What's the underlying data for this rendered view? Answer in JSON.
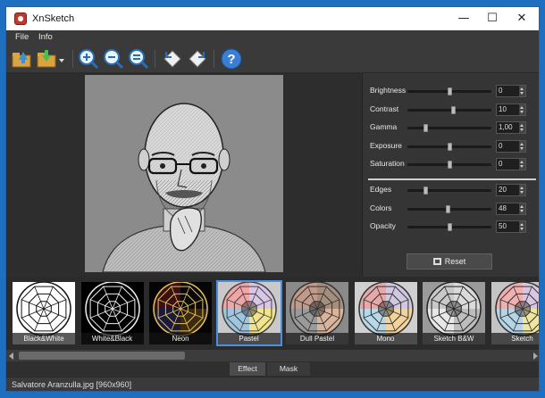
{
  "window": {
    "title": "XnSketch"
  },
  "menu": [
    "File",
    "Info"
  ],
  "toolbar": {
    "tools": [
      "open-folder-icon",
      "save-icon",
      "zoom-in-icon",
      "zoom-out-icon",
      "zoom-fit-icon",
      "rotate-left-icon",
      "rotate-right-icon",
      "help-icon"
    ]
  },
  "adjustments": {
    "group1": [
      {
        "label": "Brightness",
        "value": "0",
        "level": 0.5
      },
      {
        "label": "Contrast",
        "value": "10",
        "level": 0.55
      },
      {
        "label": "Gamma",
        "value": "1,00",
        "level": 0.2
      },
      {
        "label": "Exposure",
        "value": "0",
        "level": 0.5
      },
      {
        "label": "Saturation",
        "value": "0",
        "level": 0.5
      }
    ],
    "group2": [
      {
        "label": "Edges",
        "value": "20",
        "level": 0.2
      },
      {
        "label": "Colors",
        "value": "48",
        "level": 0.48
      },
      {
        "label": "Opacity",
        "value": "50",
        "level": 0.5
      }
    ],
    "reset_label": "Reset"
  },
  "effects": [
    {
      "label": "Black&White",
      "c": [
        "#ffffff",
        "#ffffff",
        "#ffffff",
        "#ffffff"
      ],
      "bg": "#ffffff",
      "ink": "#111111"
    },
    {
      "label": "White&Black",
      "c": [
        "#000000",
        "#000000",
        "#000000",
        "#000000"
      ],
      "bg": "#000000",
      "ink": "#f0f0f0"
    },
    {
      "label": "Neon",
      "c": [
        "#0a0a0a",
        "#3a2a10",
        "#1a1a3a",
        "#3a1010"
      ],
      "bg": "#050505",
      "ink": "#e8c060"
    },
    {
      "label": "Pastel",
      "c": [
        "#d9c6e6",
        "#f0e58c",
        "#9ec6e0",
        "#f0a6a6"
      ],
      "bg": "#c9c9c9",
      "ink": "#444444"
    },
    {
      "label": "Dull Pastel",
      "c": [
        "#a58e7e",
        "#d9b49c",
        "#9a9a9a",
        "#c29a8a"
      ],
      "bg": "#8a8a8a",
      "ink": "#333333"
    },
    {
      "label": "Mono",
      "c": [
        "#cfc8e0",
        "#f2d39a",
        "#b8d8e8",
        "#e8a8a8"
      ],
      "bg": "#d0d0d0",
      "ink": "#333333"
    },
    {
      "label": "Sketch B&W",
      "c": [
        "#dadada",
        "#bdbdbd",
        "#e8e8e8",
        "#c8c8c8"
      ],
      "bg": "#9a9a9a",
      "ink": "#222222"
    },
    {
      "label": "Sketch",
      "c": [
        "#d8c6e2",
        "#f0e5a0",
        "#b4d4e8",
        "#f0b0b0"
      ],
      "bg": "#c4c4c4",
      "ink": "#333333"
    }
  ],
  "tabs": [
    "Effect",
    "Mask"
  ],
  "status": "Salvatore Aranzulla.jpg [960x960]",
  "colors": {
    "accent": "#4a90e2",
    "desktop": "#1e6fc0"
  }
}
